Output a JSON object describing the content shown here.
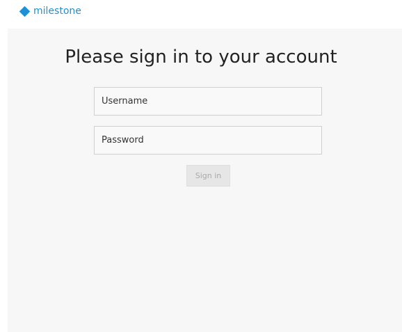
{
  "header": {
    "logo_text": "milestone",
    "logo_icon": "diamond-icon",
    "brand_color": "#1e90d6"
  },
  "login": {
    "title": "Please sign in to your account",
    "username_placeholder": "Username",
    "username_value": "",
    "password_placeholder": "Password",
    "password_value": "",
    "signin_label": "Sign in",
    "signin_state": "disabled"
  }
}
